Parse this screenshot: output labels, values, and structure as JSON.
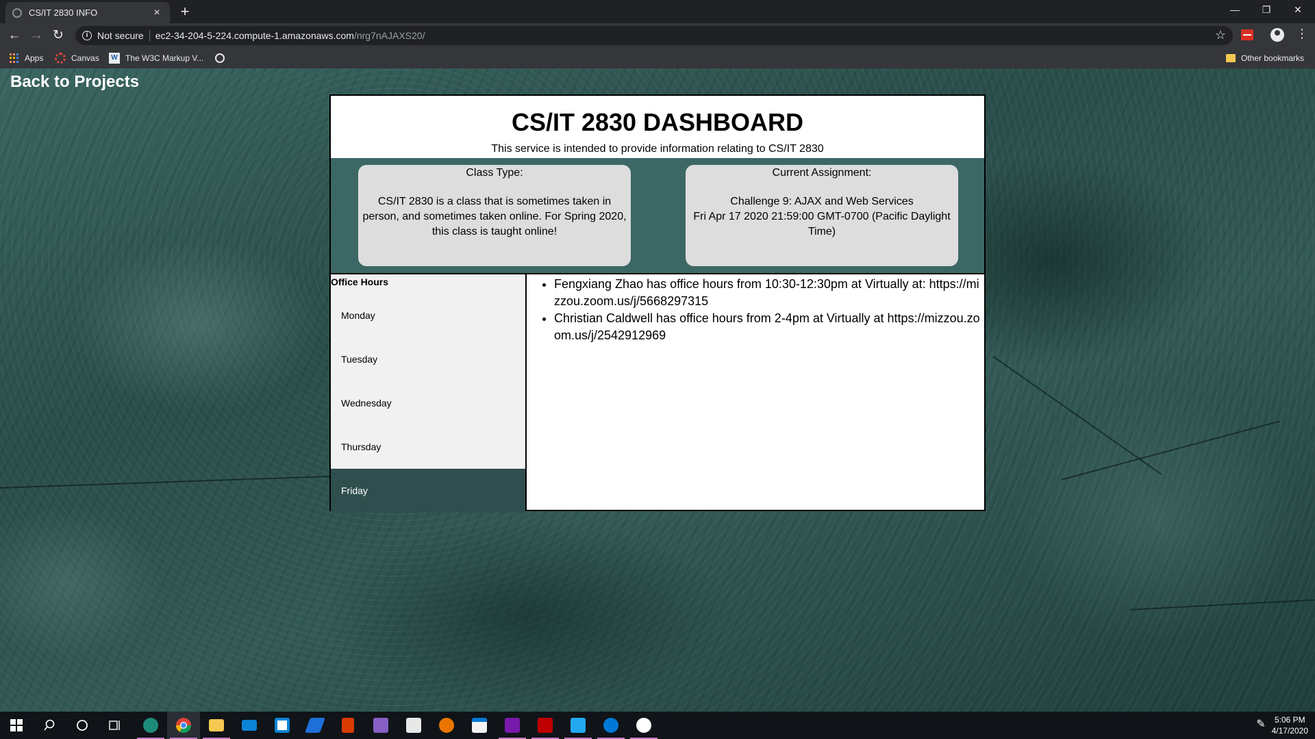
{
  "browser": {
    "tab_title": "CS/IT 2830 INFO",
    "tab_close": "×",
    "new_tab": "+",
    "window_minimize": "—",
    "window_restore": "❐",
    "window_close": "✕",
    "back": "←",
    "forward": "→",
    "reload": "↻",
    "security_label": "Not secure",
    "url_host": "ec2-34-204-5-224.compute-1.amazonaws.com",
    "url_path": "/nrg7nAJAXS20/",
    "bookmark_star": "☆",
    "menu": "⋮",
    "bookmarks": [
      {
        "label": "Apps",
        "icon": "apps-grid-icon"
      },
      {
        "label": "Canvas",
        "icon": "canvas-icon"
      },
      {
        "label": "The W3C Markup V...",
        "icon": "w3c-icon"
      },
      {
        "label": "",
        "icon": "globe-icon"
      }
    ],
    "other_bookmarks": "Other bookmarks"
  },
  "page": {
    "back_link": "Back to Projects",
    "title": "CS/IT 2830 DASHBOARD",
    "subtitle": "This service is intended to provide information relating to CS/IT 2830",
    "class_type": {
      "heading": "Class Type:",
      "body": "CS/IT 2830 is a class that is sometimes taken in person, and sometimes taken online. For Spring 2020, this class is taught online!"
    },
    "current_assignment": {
      "heading": "Current Assignment:",
      "name": "Challenge 9: AJAX and Web Services",
      "due": "Fri Apr 17 2020 21:59:00 GMT-0700 (Pacific Daylight Time)"
    },
    "office_hours": {
      "title": "Office Hours",
      "days": [
        "Monday",
        "Tuesday",
        "Wednesday",
        "Thursday",
        "Friday"
      ],
      "selected_day": "Friday",
      "entries": [
        "Fengxiang Zhao has office hours from 10:30-12:30pm at Virtually at: https://mizzou.zoom.us/j/5668297315",
        "Christian Caldwell has office hours from 2-4pm at Virtually at https://mizzou.zoom.us/j/2542912969"
      ]
    }
  },
  "taskbar": {
    "time": "5:06 PM",
    "date": "4/17/2020",
    "colors": {
      "accent": "#c879c8",
      "edge_beta": "#1d8b7a",
      "chrome": "#4285f4",
      "explorer": "#f5c851",
      "mail": "#0a84d6",
      "onenote": "#7719aa",
      "filezilla": "#bf0000",
      "vscode": "#23a9f2",
      "office": "#d83b01",
      "visual_studio": "#865fc5"
    }
  },
  "theme": {
    "card_band": "#3c6764",
    "active_day": "#2f4f4e",
    "card_bg": "#dddddd"
  }
}
